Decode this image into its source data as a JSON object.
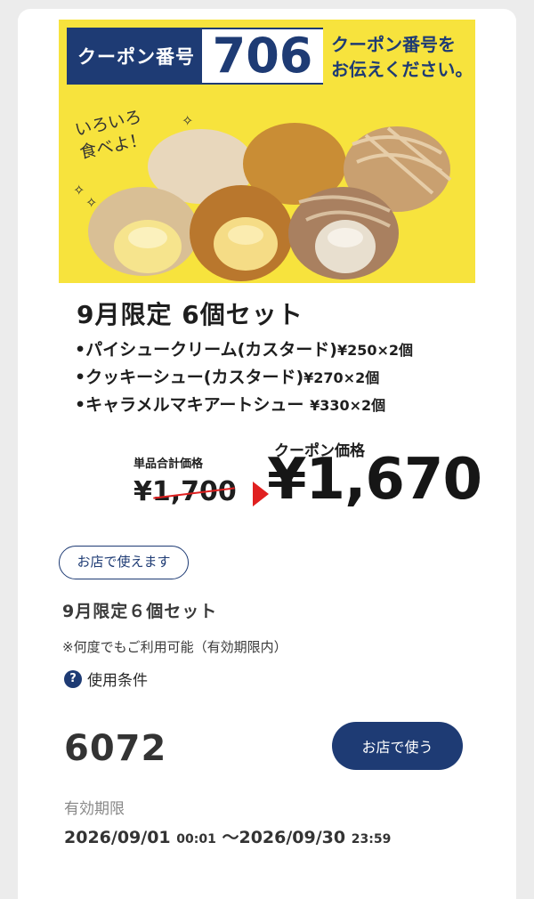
{
  "banner": {
    "coupon_label": "クーポン番号",
    "coupon_number": "706",
    "note_line1": "クーポン番号を",
    "note_line2": "お伝えください。",
    "hand_line1": "いろいろ",
    "hand_line2": "食べよ！"
  },
  "product": {
    "title": "9月限定 6個セット",
    "items": [
      {
        "name": "•パイシュークリーム(カスタード)",
        "price": "¥250×2個"
      },
      {
        "name": "•クッキーシュー(カスタード)",
        "price": "¥270×2個"
      },
      {
        "name": "•キャラメルマキアートシュー",
        "price": "¥330×2個"
      }
    ],
    "original_label": "単品合計価格",
    "original_price": "¥1,700",
    "coupon_price_label": "クーポン価格",
    "coupon_price": "¥1,670"
  },
  "meta": {
    "store_badge": "お店で使えます",
    "title": "9月限定６個セット",
    "note": "※何度でもご利用可能（有効期限内）",
    "terms_label": "使用条件",
    "help_glyph": "?",
    "code": "6072",
    "use_button": "お店で使う",
    "valid_label": "有効期限",
    "valid_start_date": "2026/09/01",
    "valid_start_time": "00:01",
    "valid_sep": "～",
    "valid_end_date": "2026/09/30",
    "valid_end_time": "23:59"
  },
  "colors": {
    "navy": "#1e3b74",
    "banner_yellow": "#f7e33d",
    "accent_red": "#e02020"
  }
}
